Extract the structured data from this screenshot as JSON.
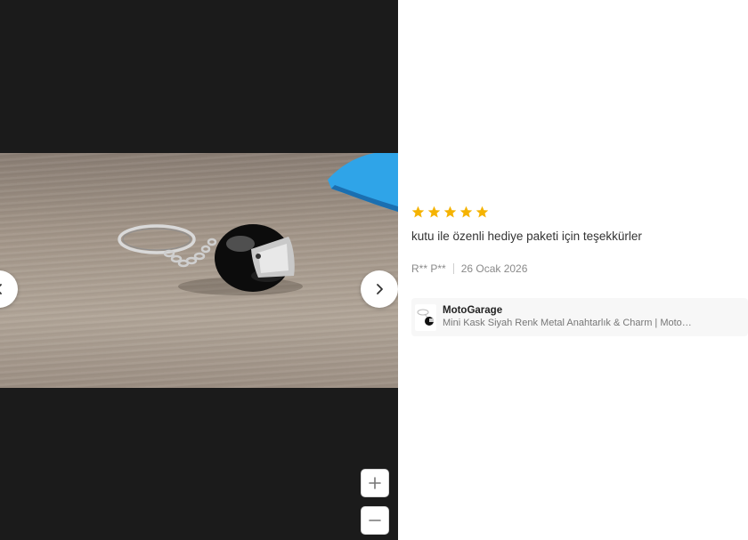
{
  "review": {
    "rating": 5,
    "rating_max": 5,
    "star_color": "#f5b301",
    "text": "kutu ile özenli hediye paketi için teşekkürler",
    "author": "R** P**",
    "date": "26 Ocak 2026"
  },
  "product": {
    "seller": "MotoGarage",
    "title": "Mini Kask Siyah Renk Metal Anahtarlık & Charm | Moto…"
  },
  "viewer": {
    "prev_icon": "chevron-left-icon",
    "next_icon": "chevron-right-icon",
    "zoom_in_icon": "plus-icon",
    "zoom_out_icon": "minus-icon",
    "background": "#1b1b1b"
  }
}
